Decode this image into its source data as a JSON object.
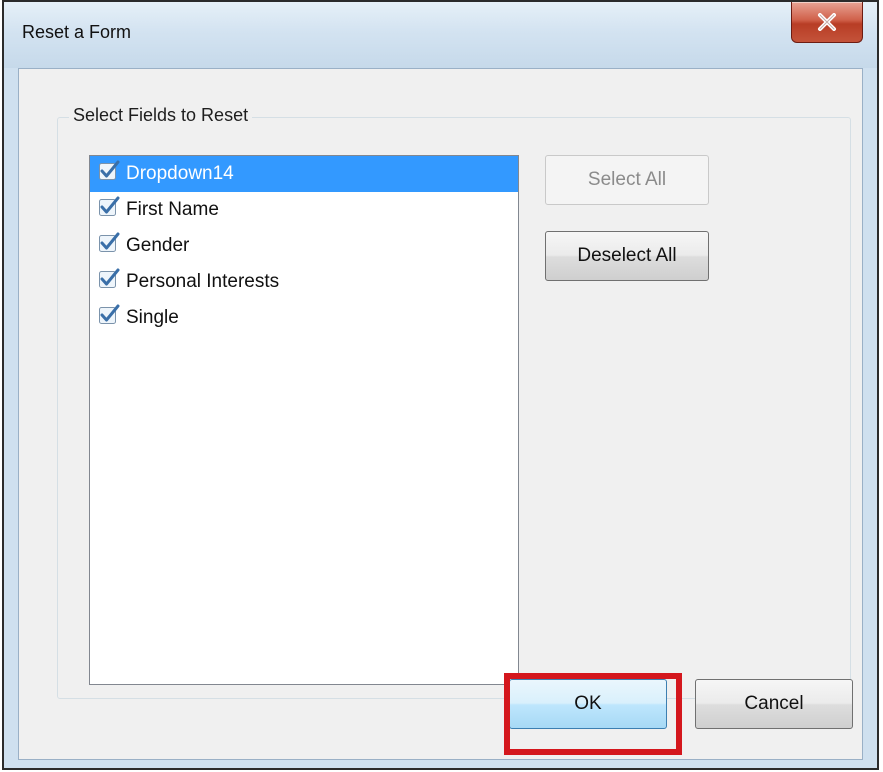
{
  "window": {
    "title": "Reset a Form"
  },
  "group": {
    "label": "Select Fields to Reset"
  },
  "fields": [
    {
      "label": "Dropdown14",
      "checked": true,
      "selected": true
    },
    {
      "label": "First Name",
      "checked": true,
      "selected": false
    },
    {
      "label": "Gender",
      "checked": true,
      "selected": false
    },
    {
      "label": "Personal Interests",
      "checked": true,
      "selected": false
    },
    {
      "label": "Single",
      "checked": true,
      "selected": false
    }
  ],
  "buttons": {
    "select_all": "Select All",
    "deselect_all": "Deselect All",
    "ok": "OK",
    "cancel": "Cancel"
  },
  "icons": {
    "close": "close-icon",
    "checkbox": "checkbox-checked-icon"
  },
  "colors": {
    "selection": "#3399ff",
    "highlight": "#d4171d",
    "close_button": "#c4533a"
  }
}
